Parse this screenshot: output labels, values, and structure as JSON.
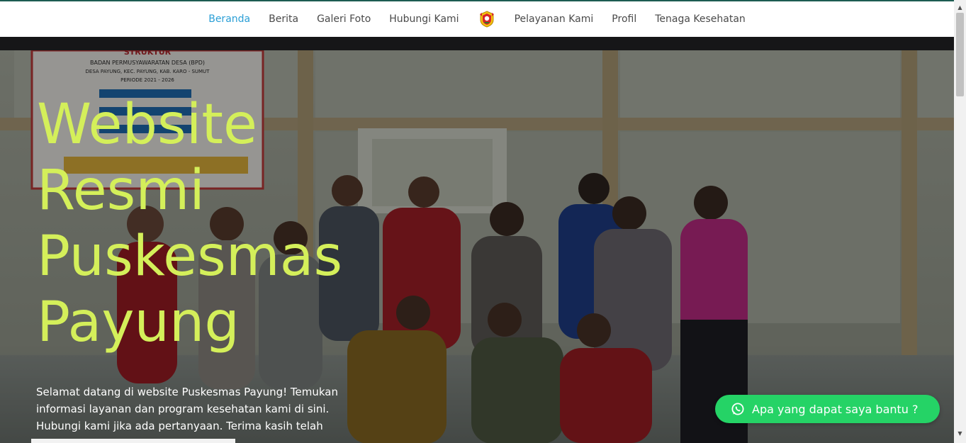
{
  "nav": {
    "items": [
      {
        "label": "Beranda",
        "active": true
      },
      {
        "label": "Berita",
        "active": false
      },
      {
        "label": "Galeri Foto",
        "active": false
      },
      {
        "label": "Hubungi Kami",
        "active": false
      },
      {
        "label": "Pelayanan Kami",
        "active": false
      },
      {
        "label": "Profil",
        "active": false
      },
      {
        "label": "Tenaga Kesehatan",
        "active": false
      }
    ],
    "active_color": "#2b9fd6",
    "logo_icon": "seal-logo-icon"
  },
  "hero": {
    "title_lines": [
      "Website",
      "Resmi",
      "Puskesmas",
      "Payung"
    ],
    "title_color": "#d4ef5a",
    "description": "Selamat datang di website Puskesmas Payung! Temukan informasi layanan dan program kesehatan kami di sini. Hubungi kami jika ada pertanyaan. Terima kasih telah",
    "background_image": "group-photo-staff-indoor",
    "banner": {
      "heading": "STRUKTUR",
      "line1": "BADAN PERMUSYAWARATAN DESA (BPD)",
      "line2": "DESA PAYUNG, KEC. PAYUNG, KAB. KARO - SUMUT",
      "line3": "PERIODE 2021 - 2026"
    }
  },
  "whatsapp": {
    "label": "Apa yang dapat saya bantu ?",
    "icon": "whatsapp-icon",
    "color": "#25d366"
  },
  "colors": {
    "top_line": "#1d5c52"
  }
}
